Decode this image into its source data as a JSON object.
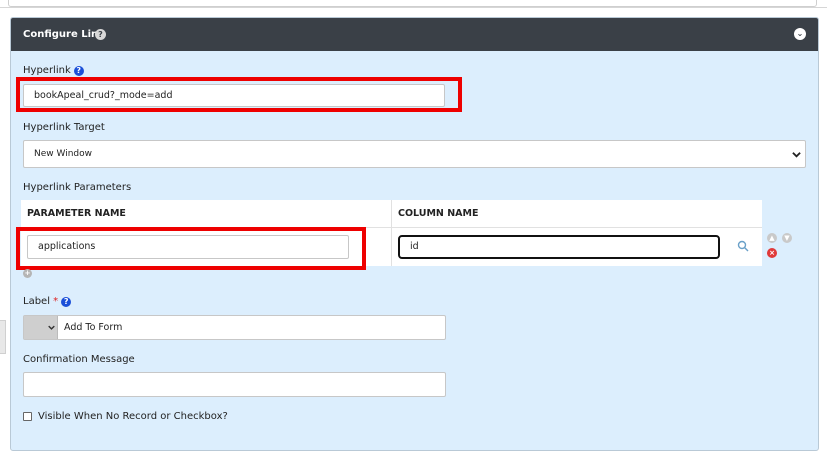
{
  "panel": {
    "title": "Configure Link",
    "help_glyph": "?",
    "collapse_glyph": "⌄"
  },
  "hyperlink": {
    "label": "Hyperlink",
    "value": "bookApeal_crud?_mode=add"
  },
  "hyperlink_target": {
    "label": "Hyperlink Target",
    "selected": "New Window"
  },
  "hyperlink_parameters": {
    "label": "Hyperlink Parameters",
    "columns": [
      "PARAMETER NAME",
      "COLUMN NAME"
    ],
    "rows": [
      {
        "parameter_name": "applications",
        "column_name": "id"
      }
    ]
  },
  "label_field": {
    "label": "Label",
    "required_mark": "*",
    "value": "Add To Form"
  },
  "confirmation_message": {
    "label": "Confirmation Message",
    "value": ""
  },
  "visible_checkbox": {
    "label": "Visible When No Record or Checkbox?"
  },
  "colors": {
    "header_bg": "#3a4047",
    "panel_bg": "#dceefd",
    "highlight": "#ee0000",
    "help_blue": "#1a4fd8",
    "remove_red": "#e03a3a"
  }
}
